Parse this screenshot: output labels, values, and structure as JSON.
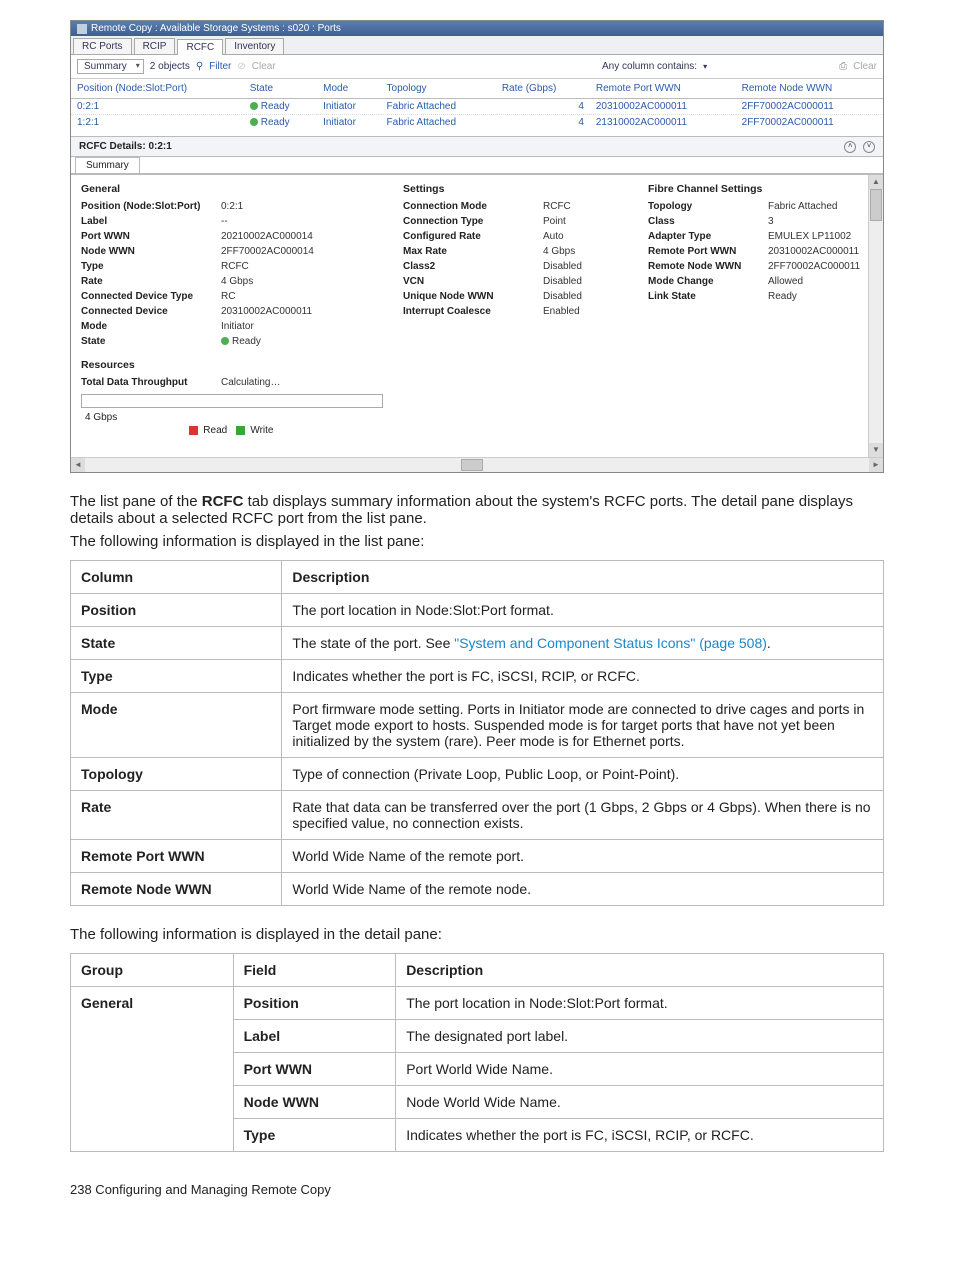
{
  "screenshot": {
    "titlebar": "Remote Copy : Available Storage Systems : s020 : Ports",
    "tabs": [
      "RC Ports",
      "RCIP",
      "RCFC",
      "Inventory"
    ],
    "active_tab": "RCFC",
    "toolbar": {
      "view_selector": "Summary",
      "object_count": "2 objects",
      "filter_label": "Filter",
      "clear_label": "Clear",
      "search_label": "Any column contains:",
      "right_clear": "Clear"
    },
    "columns": [
      "Position (Node:Slot:Port)",
      "State",
      "Mode",
      "Topology",
      "Rate (Gbps)",
      "Remote Port WWN",
      "Remote Node WWN"
    ],
    "rows": [
      {
        "pos": "0:2:1",
        "state": "Ready",
        "mode": "Initiator",
        "topology": "Fabric Attached",
        "rate": "4",
        "rpwwn": "20310002AC000011",
        "rnwwn": "2FF70002AC000011"
      },
      {
        "pos": "1:2:1",
        "state": "Ready",
        "mode": "Initiator",
        "topology": "Fabric Attached",
        "rate": "4",
        "rpwwn": "21310002AC000011",
        "rnwwn": "2FF70002AC000011"
      }
    ],
    "details_title": "RCFC Details: 0:2:1",
    "summary_tab": "Summary",
    "general": {
      "heading": "General",
      "items": {
        "position": {
          "label": "Position (Node:Slot:Port)",
          "value": "0:2:1"
        },
        "label": {
          "label": "Label",
          "value": "--"
        },
        "portwwn": {
          "label": "Port WWN",
          "value": "20210002AC000014"
        },
        "nodewwn": {
          "label": "Node WWN",
          "value": "2FF70002AC000014"
        },
        "type": {
          "label": "Type",
          "value": "RCFC"
        },
        "rate": {
          "label": "Rate",
          "value": "4 Gbps"
        },
        "cdtype": {
          "label": "Connected Device Type",
          "value": "RC"
        },
        "cdev": {
          "label": "Connected Device",
          "value": "20310002AC000011"
        },
        "mode": {
          "label": "Mode",
          "value": "Initiator"
        },
        "state": {
          "label": "State",
          "value": "Ready"
        }
      }
    },
    "settings": {
      "heading": "Settings",
      "items": {
        "cmode": {
          "label": "Connection Mode",
          "value": "RCFC"
        },
        "ctype": {
          "label": "Connection Type",
          "value": "Point"
        },
        "crate": {
          "label": "Configured Rate",
          "value": "Auto"
        },
        "mrate": {
          "label": "Max Rate",
          "value": "4 Gbps"
        },
        "class2": {
          "label": "Class2",
          "value": "Disabled"
        },
        "vcn": {
          "label": "VCN",
          "value": "Disabled"
        },
        "unw": {
          "label": "Unique Node WWN",
          "value": "Disabled"
        },
        "intc": {
          "label": "Interrupt Coalesce",
          "value": "Enabled"
        }
      }
    },
    "fcs": {
      "heading": "Fibre Channel Settings",
      "items": {
        "topology": {
          "label": "Topology",
          "value": "Fabric Attached"
        },
        "class": {
          "label": "Class",
          "value": "3"
        },
        "adapter": {
          "label": "Adapter Type",
          "value": "EMULEX LP11002"
        },
        "rpwwn": {
          "label": "Remote Port WWN",
          "value": "20310002AC000011"
        },
        "rnwwn": {
          "label": "Remote Node WWN",
          "value": "2FF70002AC000011"
        },
        "mchange": {
          "label": "Mode Change",
          "value": "Allowed"
        },
        "lstate": {
          "label": "Link State",
          "value": "Ready"
        }
      }
    },
    "resources": {
      "heading": "Resources",
      "throughput_label": "Total Data Throughput",
      "throughput_value": "Calculating…",
      "gbps_label": "4 Gbps",
      "legend_read": "Read",
      "legend_write": "Write"
    }
  },
  "copy": {
    "para1_pre": "The list pane of the ",
    "para1_bold": "RCFC",
    "para1_post": " tab displays summary information about the system's RCFC ports. The detail pane displays details about a selected RCFC port from the list pane.",
    "para2": "The following information is displayed in the list pane:",
    "table1": {
      "headers": [
        "Column",
        "Description"
      ],
      "rows": [
        {
          "c": "Position",
          "d": "The port location in Node:Slot:Port format."
        },
        {
          "c": "State",
          "d_pre": "The state of the port. See ",
          "d_link": "\"System and Component Status Icons\" (page 508)",
          "d_post": "."
        },
        {
          "c": "Type",
          "d": "Indicates whether the port is FC, iSCSI, RCIP, or RCFC."
        },
        {
          "c": "Mode",
          "d": "Port firmware mode setting. Ports in Initiator mode are connected to drive cages and ports in Target mode export to hosts. Suspended mode is for target ports that have not yet been initialized by the system (rare). Peer mode is for Ethernet ports."
        },
        {
          "c": "Topology",
          "d": "Type of connection (Private Loop, Public Loop, or Point-Point)."
        },
        {
          "c": "Rate",
          "d": "Rate that data can be transferred over the port (1 Gbps, 2 Gbps or 4 Gbps). When there is no specified value, no connection exists."
        },
        {
          "c": "Remote Port WWN",
          "d": "World Wide Name of the remote port."
        },
        {
          "c": "Remote Node WWN",
          "d": "World Wide Name of the remote node."
        }
      ]
    },
    "para3": "The following information is displayed in the detail pane:",
    "table2": {
      "headers": [
        "Group",
        "Field",
        "Description"
      ],
      "group": "General",
      "rows": [
        {
          "f": "Position",
          "d": "The port location in Node:Slot:Port format."
        },
        {
          "f": "Label",
          "d": "The designated port label."
        },
        {
          "f": "Port WWN",
          "d": "Port World Wide Name."
        },
        {
          "f": "Node WWN",
          "d": "Node World Wide Name."
        },
        {
          "f": "Type",
          "d": "Indicates whether the port is FC, iSCSI, RCIP, or RCFC."
        }
      ]
    }
  },
  "footer": "238   Configuring and Managing Remote Copy"
}
